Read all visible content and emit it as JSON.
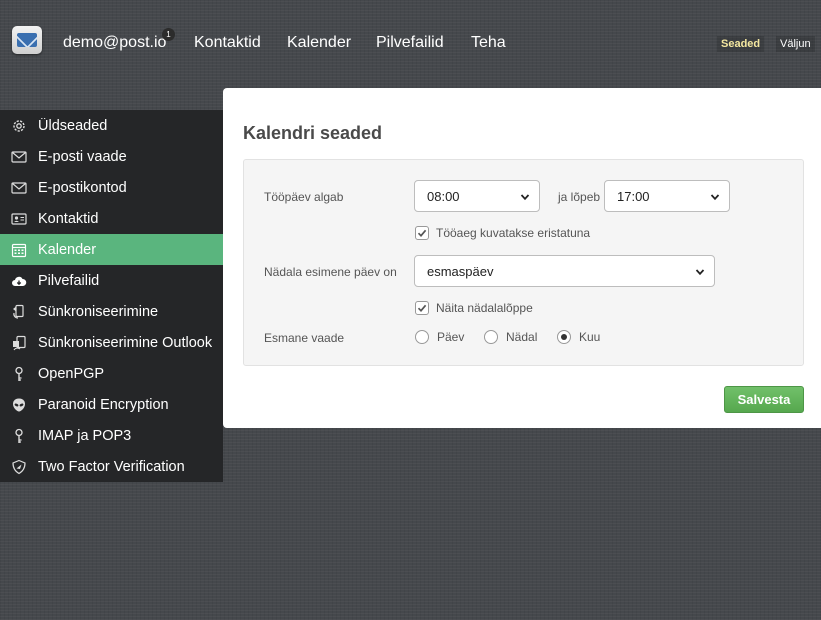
{
  "header": {
    "account": "demo@post.io",
    "account_badge": "1",
    "nav": [
      "Kontaktid",
      "Kalender",
      "Pilvefailid",
      "Teha"
    ],
    "settings_link": "Seaded",
    "logout_link": "Väljun"
  },
  "sidebar": {
    "items": [
      {
        "label": "Üldseaded",
        "icon": "gear-icon"
      },
      {
        "label": "E-posti vaade",
        "icon": "envelope-icon"
      },
      {
        "label": "E-postikontod",
        "icon": "envelope-icon"
      },
      {
        "label": "Kontaktid",
        "icon": "contact-card-icon"
      },
      {
        "label": "Kalender",
        "icon": "calendar-icon",
        "active": true
      },
      {
        "label": "Pilvefailid",
        "icon": "cloud-download-icon"
      },
      {
        "label": "Sünkroniseerimine",
        "icon": "sync-icon"
      },
      {
        "label": "Sünkroniseerimine Outlook",
        "icon": "outlook-sync-icon"
      },
      {
        "label": "OpenPGP",
        "icon": "key-icon"
      },
      {
        "label": "Paranoid Encryption",
        "icon": "alien-icon"
      },
      {
        "label": "IMAP ja POP3",
        "icon": "key-icon"
      },
      {
        "label": "Two Factor Verification",
        "icon": "shield-icon"
      }
    ],
    "active_color": "#5ab57e"
  },
  "main": {
    "title": "Kalendri seaded",
    "workday_start_label": "Tööpäev algab",
    "workday_start_value": "08:00",
    "workday_end_label": "ja lõpeb",
    "workday_end_value": "17:00",
    "highlight_worktime_label": "Tööaeg kuvatakse eristatuna",
    "highlight_worktime_checked": true,
    "week_start_label": "Nädala esimene päev on",
    "week_start_value": "esmaspäev",
    "show_weekends_label": "Näita nädalalõppe",
    "show_weekends_checked": true,
    "default_view_label": "Esmane vaade",
    "default_view_options": [
      "Päev",
      "Nädal",
      "Kuu"
    ],
    "default_view_selected": "Kuu",
    "save_label": "Salvesta"
  }
}
